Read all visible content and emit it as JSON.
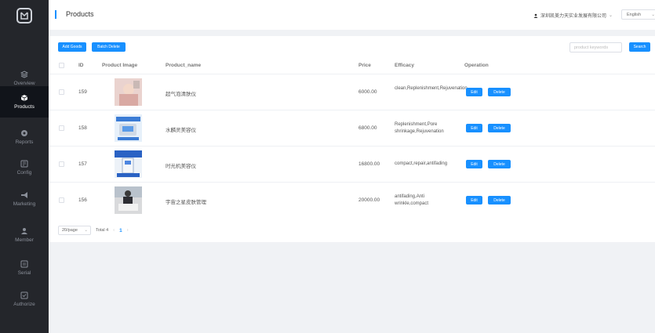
{
  "sidebar": {
    "items": [
      {
        "label": "Overview",
        "icon": "layers-icon"
      },
      {
        "label": "Products",
        "icon": "box-icon"
      },
      {
        "label": "Reports",
        "icon": "pie-icon"
      },
      {
        "label": "Config",
        "icon": "config-icon"
      },
      {
        "label": "Marketing",
        "icon": "megaphone-icon"
      },
      {
        "label": "Member",
        "icon": "member-icon"
      },
      {
        "label": "Serial",
        "icon": "serial-icon"
      },
      {
        "label": "Authorize",
        "icon": "authorize-icon"
      }
    ],
    "active": "Products"
  },
  "header": {
    "title": "Products",
    "company": "深圳凯美力天实业发展有限公司",
    "language": "English"
  },
  "toolbar": {
    "add_label": "Add Goods",
    "batch_delete_label": "Batch Delete",
    "search_placeholder": "product keywords",
    "search_label": "Search"
  },
  "table": {
    "columns": [
      "ID",
      "Product Image",
      "Product_name",
      "Price",
      "Efficacy",
      "Operation"
    ],
    "rows": [
      {
        "id": "159",
        "name": "超气泡清肤仪",
        "price": "6000.00",
        "efficacy": "clean,Replenishment,Rejuvenation",
        "edit": "Edit",
        "delete": "Delete"
      },
      {
        "id": "158",
        "name": "水麟灵美容仪",
        "price": "6800.00",
        "efficacy": "Replenishment,Pore shrinkage,Rejuvenation",
        "edit": "Edit",
        "delete": "Delete"
      },
      {
        "id": "157",
        "name": "时光机美容仪",
        "price": "16800.00",
        "efficacy": "compact,repair,antifading",
        "edit": "Edit",
        "delete": "Delete"
      },
      {
        "id": "156",
        "name": "宇宙之星皮肤管理",
        "price": "20000.00",
        "efficacy": "antifading,Anti wrinkle,compact",
        "edit": "Edit",
        "delete": "Delete"
      }
    ]
  },
  "pagination": {
    "page_size": "20/page",
    "total": "Total 4",
    "current_page": "1",
    "prev": "‹",
    "next": "›"
  },
  "colors": {
    "accent": "#1890ff",
    "sidebar_bg": "#24262b",
    "sidebar_active": "#11141a"
  }
}
